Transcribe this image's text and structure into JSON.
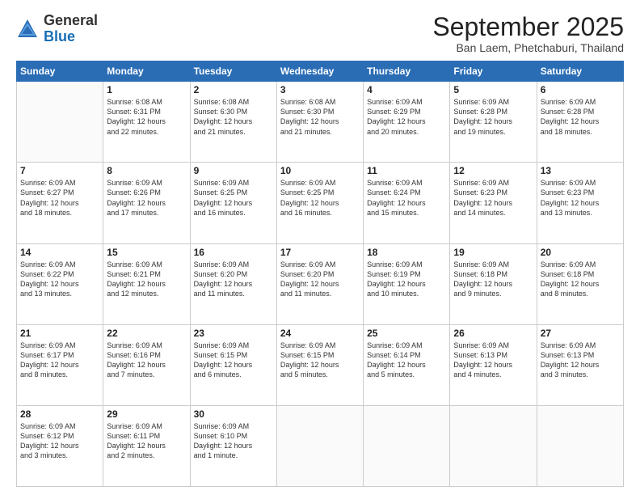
{
  "logo": {
    "general": "General",
    "blue": "Blue"
  },
  "header": {
    "month": "September 2025",
    "location": "Ban Laem, Phetchaburi, Thailand"
  },
  "weekdays": [
    "Sunday",
    "Monday",
    "Tuesday",
    "Wednesday",
    "Thursday",
    "Friday",
    "Saturday"
  ],
  "weeks": [
    [
      {
        "day": "",
        "content": ""
      },
      {
        "day": "1",
        "content": "Sunrise: 6:08 AM\nSunset: 6:31 PM\nDaylight: 12 hours\nand 22 minutes."
      },
      {
        "day": "2",
        "content": "Sunrise: 6:08 AM\nSunset: 6:30 PM\nDaylight: 12 hours\nand 21 minutes."
      },
      {
        "day": "3",
        "content": "Sunrise: 6:08 AM\nSunset: 6:30 PM\nDaylight: 12 hours\nand 21 minutes."
      },
      {
        "day": "4",
        "content": "Sunrise: 6:09 AM\nSunset: 6:29 PM\nDaylight: 12 hours\nand 20 minutes."
      },
      {
        "day": "5",
        "content": "Sunrise: 6:09 AM\nSunset: 6:28 PM\nDaylight: 12 hours\nand 19 minutes."
      },
      {
        "day": "6",
        "content": "Sunrise: 6:09 AM\nSunset: 6:28 PM\nDaylight: 12 hours\nand 18 minutes."
      }
    ],
    [
      {
        "day": "7",
        "content": "Sunrise: 6:09 AM\nSunset: 6:27 PM\nDaylight: 12 hours\nand 18 minutes."
      },
      {
        "day": "8",
        "content": "Sunrise: 6:09 AM\nSunset: 6:26 PM\nDaylight: 12 hours\nand 17 minutes."
      },
      {
        "day": "9",
        "content": "Sunrise: 6:09 AM\nSunset: 6:25 PM\nDaylight: 12 hours\nand 16 minutes."
      },
      {
        "day": "10",
        "content": "Sunrise: 6:09 AM\nSunset: 6:25 PM\nDaylight: 12 hours\nand 16 minutes."
      },
      {
        "day": "11",
        "content": "Sunrise: 6:09 AM\nSunset: 6:24 PM\nDaylight: 12 hours\nand 15 minutes."
      },
      {
        "day": "12",
        "content": "Sunrise: 6:09 AM\nSunset: 6:23 PM\nDaylight: 12 hours\nand 14 minutes."
      },
      {
        "day": "13",
        "content": "Sunrise: 6:09 AM\nSunset: 6:23 PM\nDaylight: 12 hours\nand 13 minutes."
      }
    ],
    [
      {
        "day": "14",
        "content": "Sunrise: 6:09 AM\nSunset: 6:22 PM\nDaylight: 12 hours\nand 13 minutes."
      },
      {
        "day": "15",
        "content": "Sunrise: 6:09 AM\nSunset: 6:21 PM\nDaylight: 12 hours\nand 12 minutes."
      },
      {
        "day": "16",
        "content": "Sunrise: 6:09 AM\nSunset: 6:20 PM\nDaylight: 12 hours\nand 11 minutes."
      },
      {
        "day": "17",
        "content": "Sunrise: 6:09 AM\nSunset: 6:20 PM\nDaylight: 12 hours\nand 11 minutes."
      },
      {
        "day": "18",
        "content": "Sunrise: 6:09 AM\nSunset: 6:19 PM\nDaylight: 12 hours\nand 10 minutes."
      },
      {
        "day": "19",
        "content": "Sunrise: 6:09 AM\nSunset: 6:18 PM\nDaylight: 12 hours\nand 9 minutes."
      },
      {
        "day": "20",
        "content": "Sunrise: 6:09 AM\nSunset: 6:18 PM\nDaylight: 12 hours\nand 8 minutes."
      }
    ],
    [
      {
        "day": "21",
        "content": "Sunrise: 6:09 AM\nSunset: 6:17 PM\nDaylight: 12 hours\nand 8 minutes."
      },
      {
        "day": "22",
        "content": "Sunrise: 6:09 AM\nSunset: 6:16 PM\nDaylight: 12 hours\nand 7 minutes."
      },
      {
        "day": "23",
        "content": "Sunrise: 6:09 AM\nSunset: 6:15 PM\nDaylight: 12 hours\nand 6 minutes."
      },
      {
        "day": "24",
        "content": "Sunrise: 6:09 AM\nSunset: 6:15 PM\nDaylight: 12 hours\nand 5 minutes."
      },
      {
        "day": "25",
        "content": "Sunrise: 6:09 AM\nSunset: 6:14 PM\nDaylight: 12 hours\nand 5 minutes."
      },
      {
        "day": "26",
        "content": "Sunrise: 6:09 AM\nSunset: 6:13 PM\nDaylight: 12 hours\nand 4 minutes."
      },
      {
        "day": "27",
        "content": "Sunrise: 6:09 AM\nSunset: 6:13 PM\nDaylight: 12 hours\nand 3 minutes."
      }
    ],
    [
      {
        "day": "28",
        "content": "Sunrise: 6:09 AM\nSunset: 6:12 PM\nDaylight: 12 hours\nand 3 minutes."
      },
      {
        "day": "29",
        "content": "Sunrise: 6:09 AM\nSunset: 6:11 PM\nDaylight: 12 hours\nand 2 minutes."
      },
      {
        "day": "30",
        "content": "Sunrise: 6:09 AM\nSunset: 6:10 PM\nDaylight: 12 hours\nand 1 minute."
      },
      {
        "day": "",
        "content": ""
      },
      {
        "day": "",
        "content": ""
      },
      {
        "day": "",
        "content": ""
      },
      {
        "day": "",
        "content": ""
      }
    ]
  ]
}
